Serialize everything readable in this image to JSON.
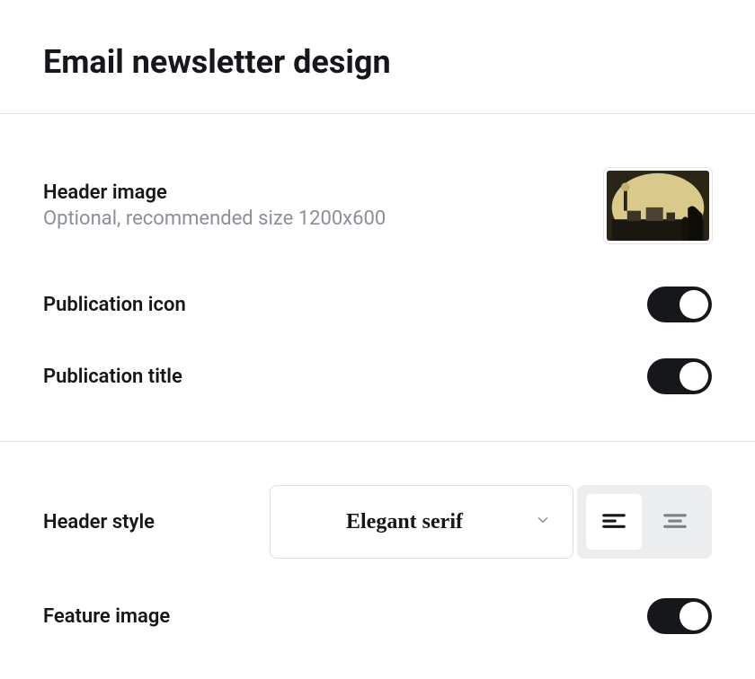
{
  "page": {
    "title": "Email newsletter design"
  },
  "settings": {
    "header_image": {
      "label": "Header image",
      "description": "Optional, recommended size 1200x600"
    },
    "publication_icon": {
      "label": "Publication icon",
      "enabled": true
    },
    "publication_title": {
      "label": "Publication title",
      "enabled": true
    },
    "header_style": {
      "label": "Header style",
      "selected": "Elegant serif",
      "alignment": "left"
    },
    "feature_image": {
      "label": "Feature image",
      "enabled": true
    }
  }
}
